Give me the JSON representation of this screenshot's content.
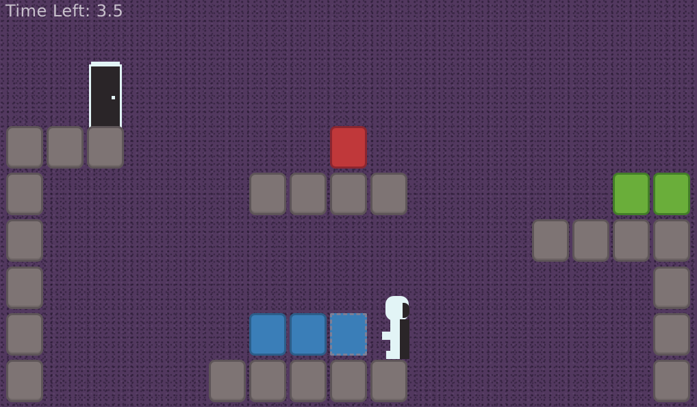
{
  "hud": {
    "time_label": "Time Left: 3.5"
  },
  "colors": {
    "background": "#52385f",
    "wall": "#7e7474",
    "red_block": "#c0383a",
    "green_block": "#6aae3a",
    "blue_block": "#3a7eb8",
    "player": "#e2f4f6",
    "door_frame": "#e2f4f6"
  },
  "icons": {
    "door": "exit-door-icon",
    "player": "player-character-icon"
  }
}
